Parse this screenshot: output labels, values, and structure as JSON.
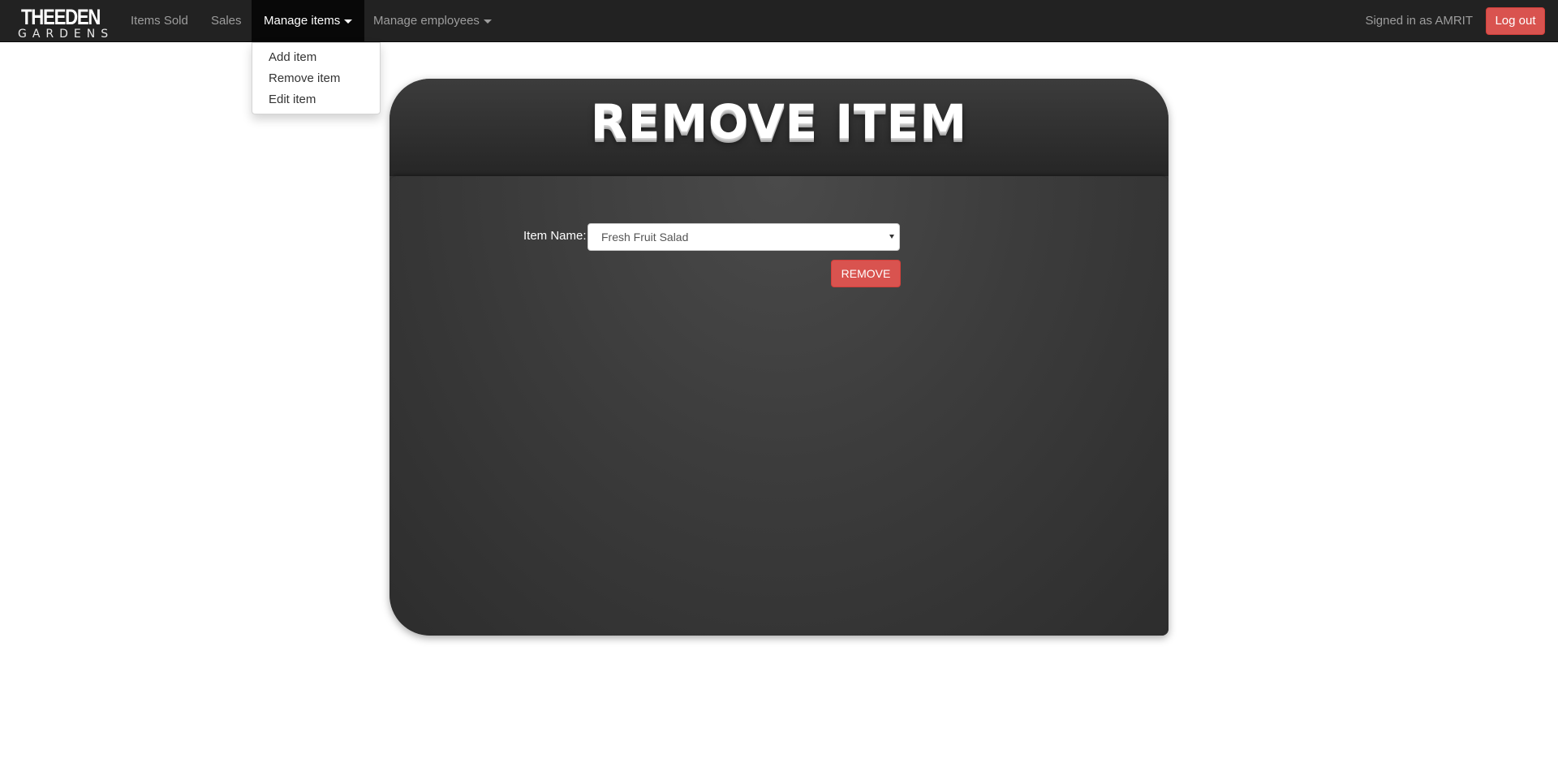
{
  "brand": {
    "line1": "THEEDEN",
    "line2": "GARDENS"
  },
  "nav": {
    "items": [
      {
        "label": "Items Sold"
      },
      {
        "label": "Sales"
      },
      {
        "label": "Manage items",
        "active": true,
        "dropdown": true
      },
      {
        "label": "Manage employees",
        "dropdown": true
      }
    ],
    "signed_in_text": "Signed in as AMRIT",
    "logout_label": "Log out"
  },
  "dropdown": {
    "items": [
      {
        "label": "Add item"
      },
      {
        "label": "Remove item"
      },
      {
        "label": "Edit item"
      }
    ]
  },
  "form": {
    "title": "REMOVE ITEM",
    "item_name_label": "Item Name:",
    "selected_item": "Fresh Fruit Salad",
    "remove_label": "REMOVE"
  },
  "colors": {
    "navbar": "#222222",
    "danger": "#d9534f",
    "card": "#333333"
  }
}
